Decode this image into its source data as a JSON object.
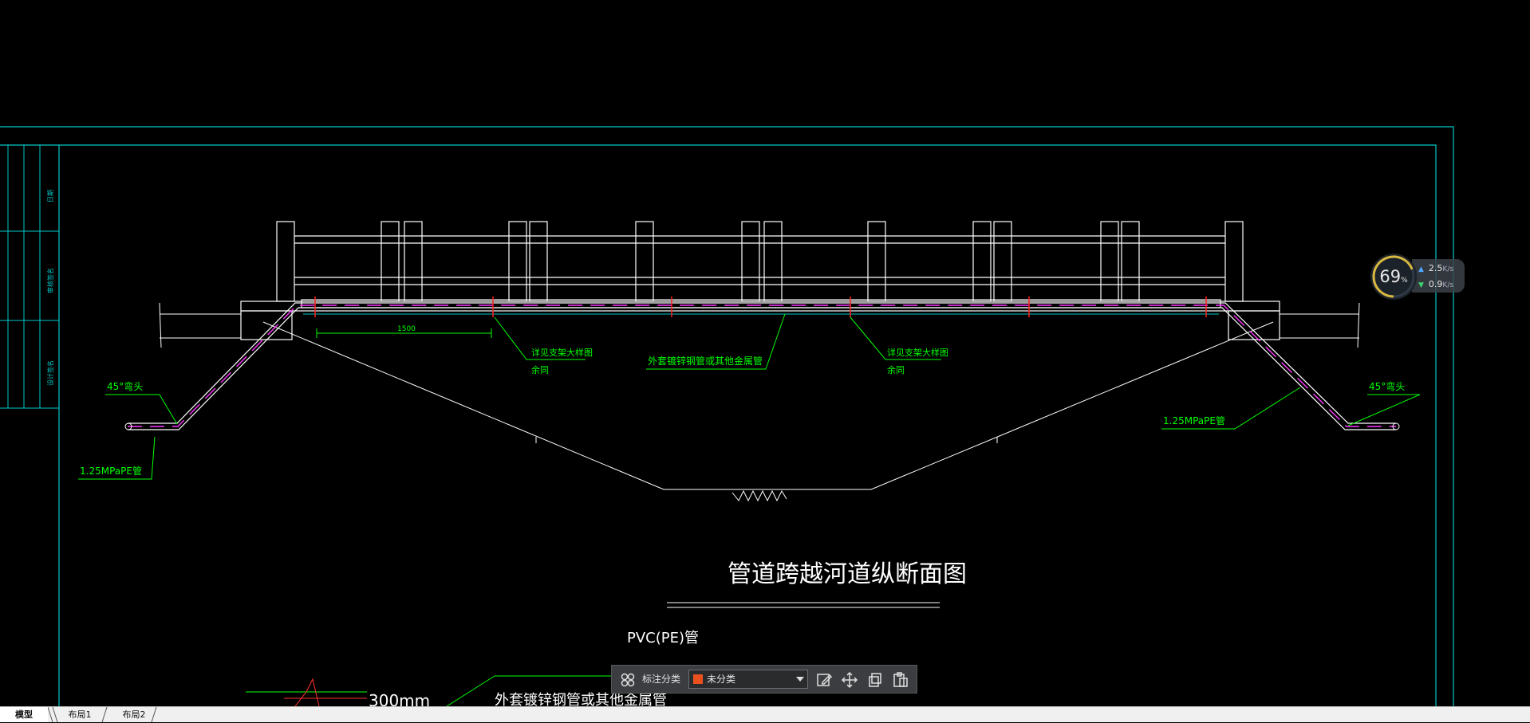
{
  "drawing": {
    "title": "管道跨越河道纵断面图",
    "dimension_1500": "1500",
    "label_elbow_left": "45°弯头",
    "label_elbow_right": "45°弯头",
    "label_pe_left": "1.25MPaPE管",
    "label_pe_right": "1.25MPaPE管",
    "label_steel_sleeve": "外套镀锌钢管或其他金属管",
    "label_support_left_1": "详见支架大样图",
    "label_support_left_2": "余同",
    "label_support_right_1": "详见支架大样图",
    "label_support_right_2": "余同",
    "label_pvc": "PVC(PE)管",
    "label_300mm": "300mm",
    "label_steel_sleeve_bottom": "外套镀锌钢管或其他金属管",
    "titleblock_1": "日期",
    "titleblock_2": "审核签名",
    "titleblock_3": "设计签名"
  },
  "net_widget": {
    "percent": "69",
    "percent_unit": "%",
    "upload": "2.5",
    "download": "0.9",
    "unit": "K/s"
  },
  "anno_toolbar": {
    "label": "标注分类",
    "selected": "未分类",
    "swatch_color": "#e8501e"
  },
  "tabs": [
    {
      "label": "模型"
    },
    {
      "label": "布局1"
    },
    {
      "label": "布局2"
    }
  ],
  "colors": {
    "frame": "#00c8c8",
    "lines": "#ffffff",
    "annotation": "#00ff00",
    "pipe": "#ff33ff",
    "marker": "#ff2020"
  }
}
